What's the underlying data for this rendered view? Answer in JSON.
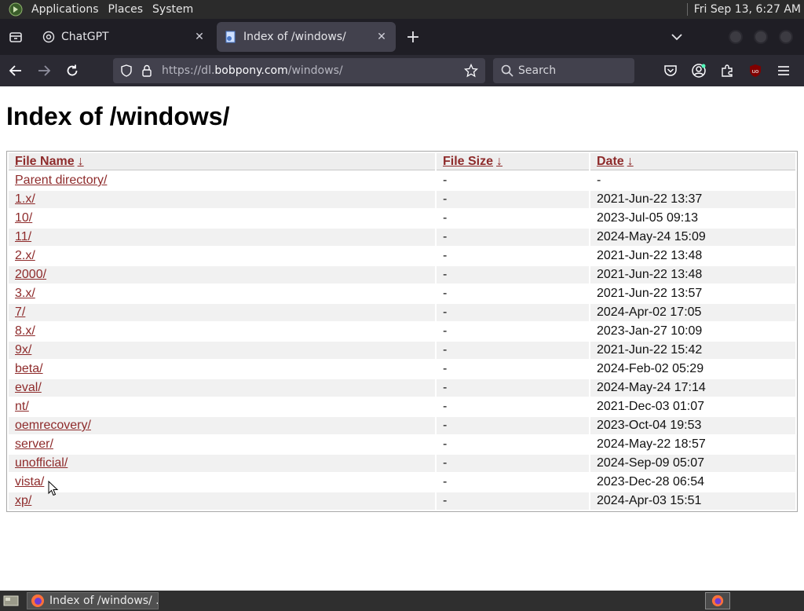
{
  "top_panel": {
    "menus": [
      "Applications",
      "Places",
      "System"
    ],
    "clock": "Fri Sep 13,  6:27 AM",
    "logo_icon": "gnome-foot-icon"
  },
  "tabs": [
    {
      "title": "ChatGPT",
      "icon": "chatgpt-logo-icon",
      "active": false
    },
    {
      "title": "Index of /windows/",
      "icon": "page-favicon-icon",
      "active": true
    }
  ],
  "nav": {
    "url_prefix": "https://dl.",
    "url_domain": "bobpony.com",
    "url_path": "/windows/",
    "search_placeholder": "Search"
  },
  "page": {
    "heading": "Index of /windows/",
    "columns": [
      {
        "label": "File Name",
        "arrow": "↓"
      },
      {
        "label": "File Size",
        "arrow": "↓"
      },
      {
        "label": "Date",
        "arrow": "↓"
      }
    ],
    "rows": [
      {
        "name": "Parent directory/",
        "size": "-",
        "date": "-"
      },
      {
        "name": "1.x/",
        "size": "-",
        "date": "2021-Jun-22 13:37"
      },
      {
        "name": "10/",
        "size": "-",
        "date": "2023-Jul-05 09:13"
      },
      {
        "name": "11/",
        "size": "-",
        "date": "2024-May-24 15:09"
      },
      {
        "name": "2.x/",
        "size": "-",
        "date": "2021-Jun-22 13:48"
      },
      {
        "name": "2000/",
        "size": "-",
        "date": "2021-Jun-22 13:48"
      },
      {
        "name": "3.x/",
        "size": "-",
        "date": "2021-Jun-22 13:57"
      },
      {
        "name": "7/",
        "size": "-",
        "date": "2024-Apr-02 17:05"
      },
      {
        "name": "8.x/",
        "size": "-",
        "date": "2023-Jan-27 10:09"
      },
      {
        "name": "9x/",
        "size": "-",
        "date": "2021-Jun-22 15:42"
      },
      {
        "name": "beta/",
        "size": "-",
        "date": "2024-Feb-02 05:29"
      },
      {
        "name": "eval/",
        "size": "-",
        "date": "2024-May-24 17:14"
      },
      {
        "name": "nt/",
        "size": "-",
        "date": "2021-Dec-03 01:07"
      },
      {
        "name": "oemrecovery/",
        "size": "-",
        "date": "2023-Oct-04 19:53"
      },
      {
        "name": "server/",
        "size": "-",
        "date": "2024-May-22 18:57"
      },
      {
        "name": "unofficial/",
        "size": "-",
        "date": "2024-Sep-09 05:07"
      },
      {
        "name": "vista/",
        "size": "-",
        "date": "2023-Dec-28 06:54"
      },
      {
        "name": "xp/",
        "size": "-",
        "date": "2024-Apr-03 15:51"
      }
    ]
  },
  "taskbar": {
    "task_label": "Index of /windows/ ..."
  },
  "colors": {
    "link": "#8e2b2b",
    "tab_active": "#42414d",
    "toolbar": "#2b2a33",
    "panel": "#2b2b2b"
  }
}
